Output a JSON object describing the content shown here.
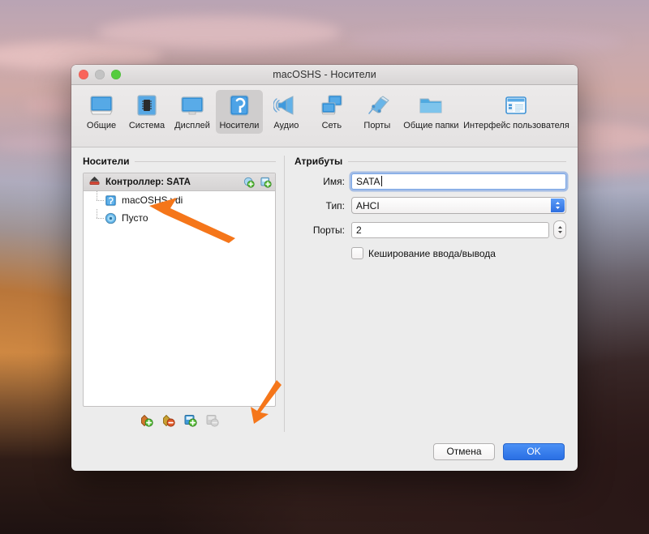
{
  "window": {
    "title": "macOSHS - Носители",
    "traffic_lights": [
      "close-red",
      "minimize-gray",
      "zoom-green"
    ]
  },
  "toolbar": {
    "items": [
      {
        "label": "Общие",
        "icon": "monitor-general-icon",
        "selected": false
      },
      {
        "label": "Система",
        "icon": "chip-system-icon",
        "selected": false
      },
      {
        "label": "Дисплей",
        "icon": "display-icon",
        "selected": false
      },
      {
        "label": "Носители",
        "icon": "storage-disk-icon",
        "selected": true
      },
      {
        "label": "Аудио",
        "icon": "speaker-audio-icon",
        "selected": false
      },
      {
        "label": "Сеть",
        "icon": "network-icon",
        "selected": false
      },
      {
        "label": "Порты",
        "icon": "ports-icon",
        "selected": false
      },
      {
        "label": "Общие папки",
        "icon": "folder-shared-icon",
        "selected": false
      },
      {
        "label": "Интерфейс пользователя",
        "icon": "user-interface-icon",
        "selected": false
      }
    ]
  },
  "storage": {
    "section_label": "Носители",
    "controller": {
      "name": "Контроллер: SATA",
      "icon": "controller-sata-icon",
      "actions": [
        {
          "name": "add-hard-disk-icon"
        },
        {
          "name": "add-optical-drive-icon"
        }
      ]
    },
    "attachments": [
      {
        "name": "macOSHS.vdi",
        "icon": "hard-disk-icon",
        "selected": false
      },
      {
        "name": "Пусто",
        "icon": "optical-disc-icon",
        "selected": false
      }
    ],
    "toolbar_buttons": [
      {
        "name": "add-controller-button",
        "icon": "add-controller-icon",
        "disabled": false
      },
      {
        "name": "remove-controller-button",
        "icon": "remove-controller-icon",
        "disabled": false
      },
      {
        "name": "add-attachment-button",
        "icon": "add-attachment-icon",
        "disabled": false
      },
      {
        "name": "remove-attachment-button",
        "icon": "remove-attachment-icon",
        "disabled": true
      }
    ]
  },
  "attributes": {
    "section_label": "Атрибуты",
    "name_label": "Имя:",
    "name_value": "SATA",
    "type_label": "Тип:",
    "type_value": "AHCI",
    "type_options": [
      "AHCI"
    ],
    "ports_label": "Порты:",
    "ports_value": "2",
    "cache_checkbox_label": "Кеширование ввода/вывода",
    "cache_checked": false
  },
  "footer": {
    "cancel_label": "Отмена",
    "ok_label": "OK"
  },
  "annotations": {
    "arrow_color": "#F5761A",
    "arrows": [
      {
        "name": "arrow-pointing-to-empty-optical-drive",
        "target": "Пусто"
      },
      {
        "name": "arrow-pointing-to-remove-attachment-button",
        "target": "remove-attachment-button"
      }
    ]
  },
  "colors": {
    "accent_blue": "#2a6fe4",
    "window_bg": "#ececec",
    "panel_bg": "#ffffff",
    "arrow_orange": "#F5761A"
  }
}
